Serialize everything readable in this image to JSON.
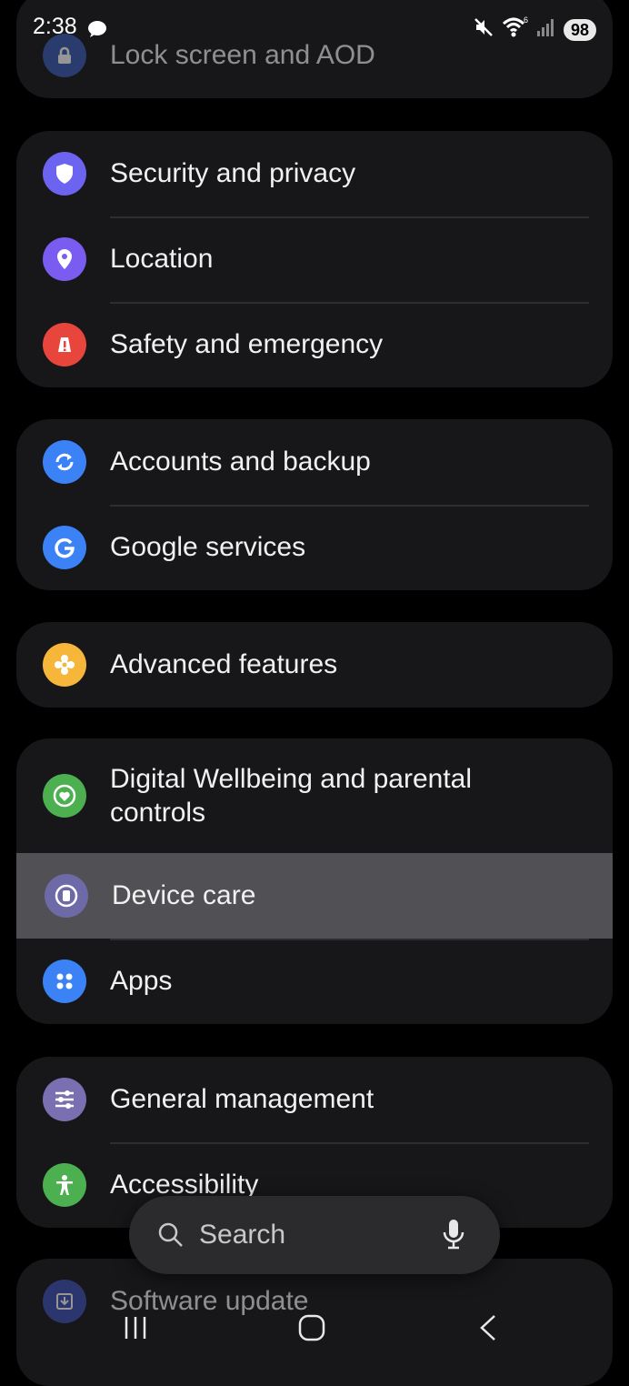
{
  "status_bar": {
    "time": "2:38",
    "battery": "98"
  },
  "settings": {
    "lock_screen": "Lock screen and AOD",
    "security": "Security and privacy",
    "location": "Location",
    "safety": "Safety and emergency",
    "accounts": "Accounts and backup",
    "google": "Google services",
    "advanced": "Advanced features",
    "wellbeing": "Digital Wellbeing and parental controls",
    "device_care": "Device care",
    "apps": "Apps",
    "general": "General management",
    "accessibility": "Accessibility",
    "software_update": "Software update"
  },
  "search": {
    "placeholder": "Search"
  },
  "icons": {
    "lock": "lock-icon",
    "security": "shield-icon",
    "location": "location-pin-icon",
    "safety": "warning-icon",
    "accounts": "sync-icon",
    "google": "google-icon",
    "advanced": "gear-flower-icon",
    "wellbeing": "heart-icon",
    "device_care": "device-care-icon",
    "apps": "apps-grid-icon",
    "general": "sliders-icon",
    "accessibility": "person-icon",
    "software_update": "download-icon"
  },
  "colors": {
    "security": "#6c63f0",
    "location": "#7a5cf0",
    "safety": "#e8463c",
    "accounts": "#3b82f6",
    "google": "#3b82f6",
    "advanced": "#f6b63a",
    "wellbeing": "#4caf50",
    "device_care": "#6e6aa8",
    "apps": "#3b82f6",
    "general": "#7a6fb0",
    "accessibility": "#4caf50",
    "software_update": "#3f51b5"
  }
}
